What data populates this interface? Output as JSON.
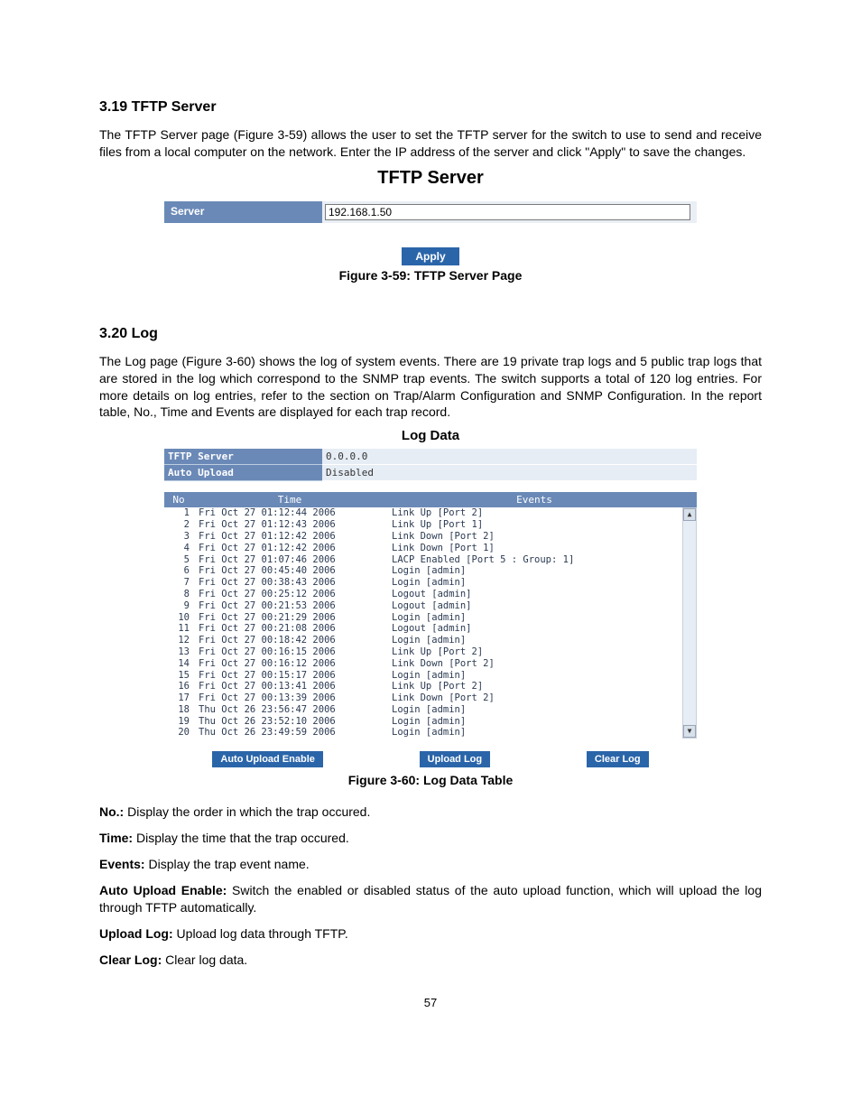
{
  "section_tftp": {
    "heading": "3.19  TFTP Server",
    "body": "The TFTP Server page (Figure 3-59) allows the user to set the TFTP server for the switch to use to send and receive files from a local computer on the network. Enter the IP address of the server and click \"Apply\" to save the changes.",
    "panel": {
      "title": "TFTP Server",
      "row_label": "Server",
      "input_value": "192.168.1.50",
      "apply_label": "Apply"
    },
    "caption": "Figure 3-59: TFTP Server Page"
  },
  "section_log": {
    "heading": "3.20  Log",
    "body": "The Log page (Figure 3-60) shows the log of system events. There are 19 private trap logs and 5 public trap logs that are stored in the log which correspond to the SNMP trap events. The switch supports a total of 120 log entries. For more details on log entries, refer to the section on Trap/Alarm Configuration and SNMP Configuration. In the report table, No., Time and Events are displayed for each trap record.",
    "panel": {
      "title": "Log Data",
      "tftp_server_label": "TFTP Server",
      "tftp_server_value": "0.0.0.0",
      "auto_upload_label": "Auto Upload",
      "auto_upload_value": "Disabled",
      "headers": {
        "no": "No",
        "time": "Time",
        "events": "Events"
      },
      "rows": [
        {
          "no": "1",
          "time": "Fri Oct 27 01:12:44 2006",
          "event": "Link Up [Port 2]"
        },
        {
          "no": "2",
          "time": "Fri Oct 27 01:12:43 2006",
          "event": "Link Up [Port 1]"
        },
        {
          "no": "3",
          "time": "Fri Oct 27 01:12:42 2006",
          "event": "Link Down [Port 2]"
        },
        {
          "no": "4",
          "time": "Fri Oct 27 01:12:42 2006",
          "event": "Link Down [Port 1]"
        },
        {
          "no": "5",
          "time": "Fri Oct 27 01:07:46 2006",
          "event": "LACP Enabled [Port 5 : Group: 1]"
        },
        {
          "no": "6",
          "time": "Fri Oct 27 00:45:40 2006",
          "event": "Login [admin]"
        },
        {
          "no": "7",
          "time": "Fri Oct 27 00:38:43 2006",
          "event": "Login [admin]"
        },
        {
          "no": "8",
          "time": "Fri Oct 27 00:25:12 2006",
          "event": "Logout [admin]"
        },
        {
          "no": "9",
          "time": "Fri Oct 27 00:21:53 2006",
          "event": "Logout [admin]"
        },
        {
          "no": "10",
          "time": "Fri Oct 27 00:21:29 2006",
          "event": "Login [admin]"
        },
        {
          "no": "11",
          "time": "Fri Oct 27 00:21:08 2006",
          "event": "Logout [admin]"
        },
        {
          "no": "12",
          "time": "Fri Oct 27 00:18:42 2006",
          "event": "Login [admin]"
        },
        {
          "no": "13",
          "time": "Fri Oct 27 00:16:15 2006",
          "event": "Link Up [Port 2]"
        },
        {
          "no": "14",
          "time": "Fri Oct 27 00:16:12 2006",
          "event": "Link Down [Port 2]"
        },
        {
          "no": "15",
          "time": "Fri Oct 27 00:15:17 2006",
          "event": "Login [admin]"
        },
        {
          "no": "16",
          "time": "Fri Oct 27 00:13:41 2006",
          "event": "Link Up [Port 2]"
        },
        {
          "no": "17",
          "time": "Fri Oct 27 00:13:39 2006",
          "event": "Link Down [Port 2]"
        },
        {
          "no": "18",
          "time": "Thu Oct 26 23:56:47 2006",
          "event": "Login [admin]"
        },
        {
          "no": "19",
          "time": "Thu Oct 26 23:52:10 2006",
          "event": "Login [admin]"
        },
        {
          "no": "20",
          "time": "Thu Oct 26 23:49:59 2006",
          "event": "Login [admin]"
        }
      ],
      "buttons": {
        "auto_enable": "Auto Upload Enable",
        "upload": "Upload Log",
        "clear": "Clear Log"
      }
    },
    "caption": "Figure 3-60: Log Data Table"
  },
  "definitions": {
    "no_label": "No.:",
    "no_text": " Display the order in which the trap occured.",
    "time_label": "Time:",
    "time_text": " Display the time that the trap occured.",
    "events_label": "Events:",
    "events_text": " Display the trap event name.",
    "auto_label": "Auto Upload Enable:",
    "auto_text": " Switch the enabled or disabled status of the auto upload function, which will upload the log through TFTP automatically.",
    "upload_label": "Upload Log:",
    "upload_text": " Upload log data through TFTP.",
    "clear_label": "Clear Log:",
    "clear_text": " Clear log data."
  },
  "page_number": "57"
}
